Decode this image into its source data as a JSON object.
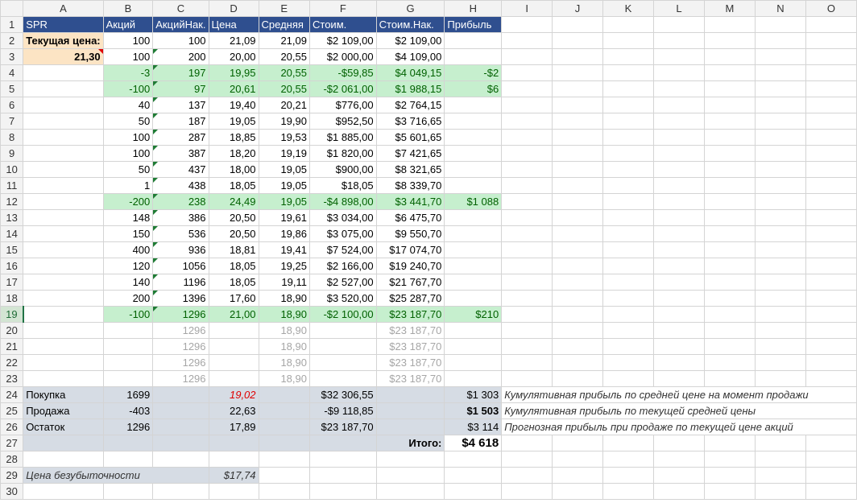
{
  "columns": [
    "A",
    "B",
    "C",
    "D",
    "E",
    "F",
    "G",
    "H",
    "I",
    "J",
    "K",
    "L",
    "M",
    "N",
    "O"
  ],
  "header": {
    "a": "SPR",
    "b": "Акций",
    "c": "АкцийНак.",
    "d": "Цена",
    "e": "Средняя",
    "f": "Стоим.",
    "g": "Стоим.Нак.",
    "h": "Прибыль"
  },
  "current": {
    "label": "Текущая цена:",
    "value": "21,30"
  },
  "rows": [
    {
      "n": "2",
      "b": "100",
      "c": "100",
      "d": "21,09",
      "e": "21,09",
      "f": "$2 109,00",
      "g": "$2 109,00",
      "h": ""
    },
    {
      "n": "3",
      "b": "100",
      "c": "200",
      "d": "20,00",
      "e": "20,55",
      "f": "$2 000,00",
      "g": "$4 109,00",
      "h": ""
    },
    {
      "n": "4",
      "b": "-3",
      "c": "197",
      "d": "19,95",
      "e": "20,55",
      "f": "-$59,85",
      "g": "$4 049,15",
      "h": "-$2"
    },
    {
      "n": "5",
      "b": "-100",
      "c": "97",
      "d": "20,61",
      "e": "20,55",
      "f": "-$2 061,00",
      "g": "$1 988,15",
      "h": "$6"
    },
    {
      "n": "6",
      "b": "40",
      "c": "137",
      "d": "19,40",
      "e": "20,21",
      "f": "$776,00",
      "g": "$2 764,15",
      "h": ""
    },
    {
      "n": "7",
      "b": "50",
      "c": "187",
      "d": "19,05",
      "e": "19,90",
      "f": "$952,50",
      "g": "$3 716,65",
      "h": ""
    },
    {
      "n": "8",
      "b": "100",
      "c": "287",
      "d": "18,85",
      "e": "19,53",
      "f": "$1 885,00",
      "g": "$5 601,65",
      "h": ""
    },
    {
      "n": "9",
      "b": "100",
      "c": "387",
      "d": "18,20",
      "e": "19,19",
      "f": "$1 820,00",
      "g": "$7 421,65",
      "h": ""
    },
    {
      "n": "10",
      "b": "50",
      "c": "437",
      "d": "18,00",
      "e": "19,05",
      "f": "$900,00",
      "g": "$8 321,65",
      "h": ""
    },
    {
      "n": "11",
      "b": "1",
      "c": "438",
      "d": "18,05",
      "e": "19,05",
      "f": "$18,05",
      "g": "$8 339,70",
      "h": ""
    },
    {
      "n": "12",
      "b": "-200",
      "c": "238",
      "d": "24,49",
      "e": "19,05",
      "f": "-$4 898,00",
      "g": "$3 441,70",
      "h": "$1 088"
    },
    {
      "n": "13",
      "b": "148",
      "c": "386",
      "d": "20,50",
      "e": "19,61",
      "f": "$3 034,00",
      "g": "$6 475,70",
      "h": ""
    },
    {
      "n": "14",
      "b": "150",
      "c": "536",
      "d": "20,50",
      "e": "19,86",
      "f": "$3 075,00",
      "g": "$9 550,70",
      "h": ""
    },
    {
      "n": "15",
      "b": "400",
      "c": "936",
      "d": "18,81",
      "e": "19,41",
      "f": "$7 524,00",
      "g": "$17 074,70",
      "h": ""
    },
    {
      "n": "16",
      "b": "120",
      "c": "1056",
      "d": "18,05",
      "e": "19,25",
      "f": "$2 166,00",
      "g": "$19 240,70",
      "h": ""
    },
    {
      "n": "17",
      "b": "140",
      "c": "1196",
      "d": "18,05",
      "e": "19,11",
      "f": "$2 527,00",
      "g": "$21 767,70",
      "h": ""
    },
    {
      "n": "18",
      "b": "200",
      "c": "1396",
      "d": "17,60",
      "e": "18,90",
      "f": "$3 520,00",
      "g": "$25 287,70",
      "h": ""
    },
    {
      "n": "19",
      "b": "-100",
      "c": "1296",
      "d": "21,00",
      "e": "18,90",
      "f": "-$2 100,00",
      "g": "$23 187,70",
      "h": "$210"
    },
    {
      "n": "20",
      "b": "",
      "c": "1296",
      "d": "",
      "e": "18,90",
      "f": "",
      "g": "$23 187,70",
      "h": ""
    },
    {
      "n": "21",
      "b": "",
      "c": "1296",
      "d": "",
      "e": "18,90",
      "f": "",
      "g": "$23 187,70",
      "h": ""
    },
    {
      "n": "22",
      "b": "",
      "c": "1296",
      "d": "",
      "e": "18,90",
      "f": "",
      "g": "$23 187,70",
      "h": ""
    },
    {
      "n": "23",
      "b": "",
      "c": "1296",
      "d": "",
      "e": "18,90",
      "f": "",
      "g": "$23 187,70",
      "h": ""
    }
  ],
  "summary": {
    "buy": {
      "label": "Покупка",
      "shares": "1699",
      "price": "19,02",
      "cost": "$32 306,55",
      "profit": "$1 303",
      "note": "Кумулятивная прибыль по средней цене на момент продажи"
    },
    "sell": {
      "label": "Продажа",
      "shares": "-403",
      "price": "22,63",
      "cost": "-$9 118,85",
      "profit": "$1 503",
      "note": "Кумулятивная прибыль по текущей средней цены"
    },
    "rest": {
      "label": "Остаток",
      "shares": "1296",
      "price": "17,89",
      "cost": "$23 187,70",
      "profit": "$3 114",
      "note": "Прогнозная прибыль при продаже по текущей цене акций"
    },
    "total_label": "Итого:",
    "total_value": "$4 618"
  },
  "breakeven": {
    "label": "Цена безубыточности",
    "value": "$17,74"
  },
  "row_numbers": {
    "r24": "24",
    "r25": "25",
    "r26": "26",
    "r27": "27",
    "r28": "28",
    "r29": "29",
    "r30": "30"
  }
}
